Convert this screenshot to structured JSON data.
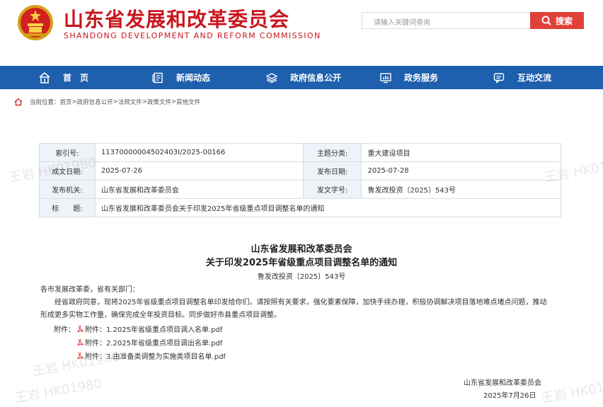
{
  "header": {
    "site_title": "山东省发展和改革委员会",
    "site_subtitle": "SHANDONG DEVELOPMENT AND REFORM COMMISSION",
    "search_placeholder": "请输入关键词查询",
    "search_button": "搜索"
  },
  "nav": {
    "items": [
      {
        "label": "首　页",
        "icon": "home-icon"
      },
      {
        "label": "新闻动态",
        "icon": "news-icon"
      },
      {
        "label": "政府信息公开",
        "icon": "layers-icon"
      },
      {
        "label": "政务服务",
        "icon": "chart-monitor-icon"
      },
      {
        "label": "互动交流",
        "icon": "chat-icon"
      }
    ]
  },
  "breadcrumb": {
    "prefix": "当前位置：",
    "items": [
      "首页",
      "政府信息公开",
      "法规文件",
      "政策文件",
      "其他文件"
    ],
    "separator": " > "
  },
  "meta": {
    "index_label": "索引号:",
    "index_value": "11370000004502403I/2025-00166",
    "topic_label": "主题分类:",
    "topic_value": "重大建设项目",
    "created_label": "成文日期:",
    "created_value": "2025-07-26",
    "published_label": "发布日期:",
    "published_value": "2025-07-28",
    "issuer_label": "发布机关:",
    "issuer_value": "山东省发展和改革委员会",
    "docno_label": "发文字号:",
    "docno_value": "鲁发改投资〔2025〕543号",
    "title_label": "标　　题:",
    "title_value": "山东省发展和改革委员会关于印发2025年省级重点项目调整名单的通知"
  },
  "doc": {
    "org": "山东省发展和改革委员会",
    "title": "关于印发2025年省级重点项目调整名单的通知",
    "number": "鲁发改投资〔2025〕543号",
    "salutation": "各市发展改革委，省有关部门：",
    "body": "经省政府同意，现将2025年省级重点项目调整名单印发给你们。请按照有关要求，强化要素保障，加快手续办理，积极协调解决项目落地难点堵点问题，推动形成更多实物工作量，确保完成全年投资目标。同步做好市县重点项目调整。",
    "attachments_label": "附件：",
    "attachments": [
      "附件：1.2025年省级重点项目调入名单.pdf",
      "附件：2.2025年省级重点项目调出名单.pdf",
      "附件：3.由准备类调整为实施类项目名单.pdf"
    ],
    "signature": "山东省发展和改革委员会",
    "sign_date": "2025年7月26日"
  },
  "watermark": "王岩 HK01980",
  "colors": {
    "brand_red": "#c8151d",
    "nav_blue": "#1e5fae",
    "search_red": "#e0403a",
    "label_bg": "#eef3f9"
  }
}
